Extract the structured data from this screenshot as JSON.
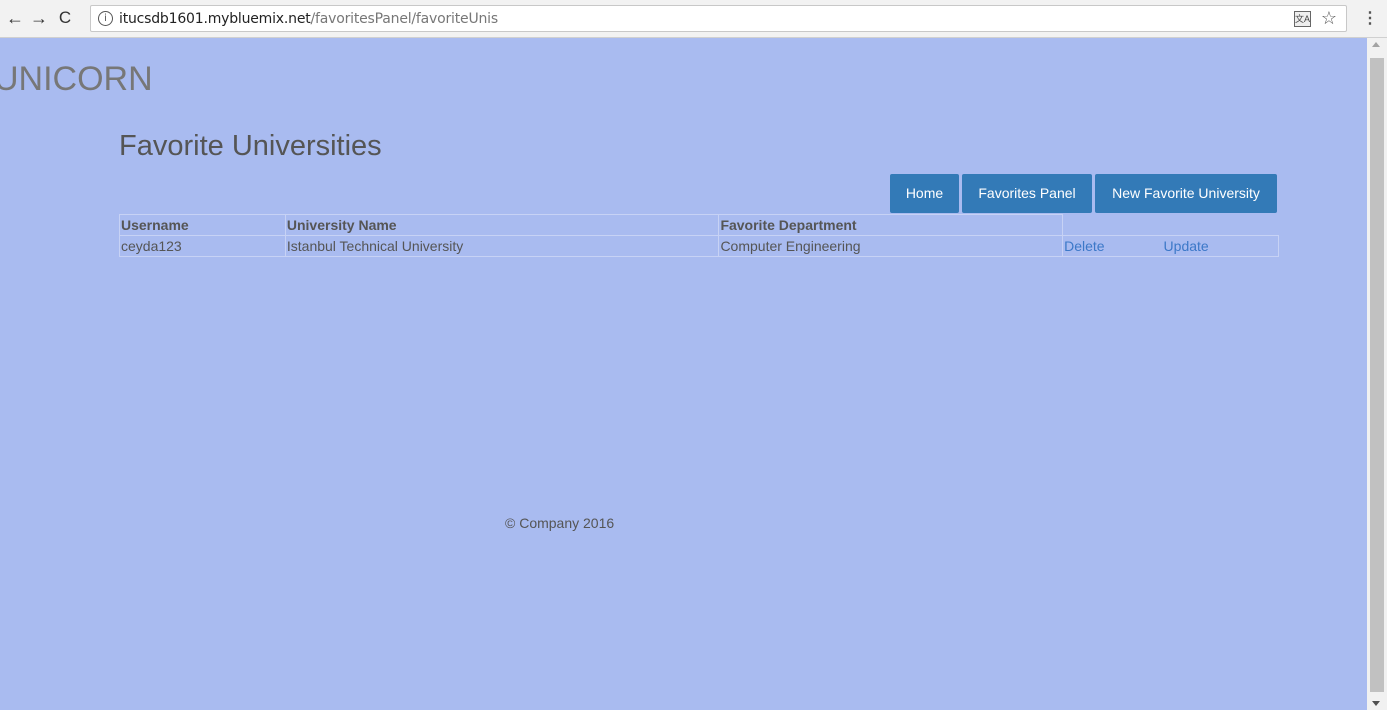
{
  "browser": {
    "url_host": "itucsdb1601.mybluemix.net",
    "url_path": "/favoritesPanel/favoriteUnis",
    "back_icon": "←",
    "forward_icon": "→",
    "reload_icon": "C",
    "info_icon": "i",
    "star_icon": "☆",
    "menu_icon": "⋮"
  },
  "brand": "UNICORN",
  "page_title": "Favorite Universities",
  "nav": {
    "home": "Home",
    "favorites_panel": "Favorites Panel",
    "new_favorite": "New Favorite University"
  },
  "table": {
    "headers": [
      "Username",
      "University Name",
      "Favorite Department"
    ],
    "rows": [
      {
        "username": "ceyda123",
        "university": "Istanbul Technical University",
        "department": "Computer Engineering",
        "delete": "Delete",
        "update": "Update"
      }
    ]
  },
  "footer": "© Company 2016",
  "colors": {
    "page_bg": "#a9bbf0",
    "button_bg": "#337ab7",
    "link": "#3c78c8"
  }
}
